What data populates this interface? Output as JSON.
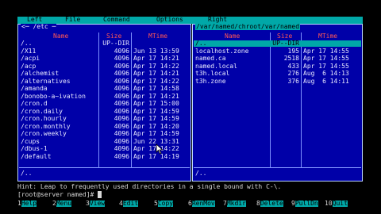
{
  "menu": [
    "Left",
    "File",
    "Command",
    "Options",
    "Right"
  ],
  "left_panel": {
    "path": "<─ /etc ─",
    "columns": {
      "name": "Name",
      "size": "Size",
      "mtime": "MTime"
    },
    "rows": [
      {
        "name": "/..",
        "size": "UP--DIR",
        "mtime": ""
      },
      {
        "name": "/X11",
        "size": "4096",
        "mtime": "Jun 13 13:59"
      },
      {
        "name": "/acpi",
        "size": "4096",
        "mtime": "Apr 17 14:21"
      },
      {
        "name": "/acp",
        "size": "4096",
        "mtime": "Apr 17 14:22"
      },
      {
        "name": "/alchemist",
        "size": "4096",
        "mtime": "Apr 17 14:21"
      },
      {
        "name": "/alternatives",
        "size": "4096",
        "mtime": "Apr 17 14:22"
      },
      {
        "name": "/amanda",
        "size": "4096",
        "mtime": "Apr 17 14:58"
      },
      {
        "name": "/bonobo-a~ivation",
        "size": "4096",
        "mtime": "Apr 17 14:21"
      },
      {
        "name": "/cron.d",
        "size": "4096",
        "mtime": "Apr 17 15:00"
      },
      {
        "name": "/cron.daily",
        "size": "4096",
        "mtime": "Apr 17 14:59"
      },
      {
        "name": "/cron.hourly",
        "size": "4096",
        "mtime": "Apr 17 14:59"
      },
      {
        "name": "/cron.monthly",
        "size": "4096",
        "mtime": "Apr 17 14:20"
      },
      {
        "name": "/cron.weekly",
        "size": "4096",
        "mtime": "Apr 17 14:59"
      },
      {
        "name": "/cups",
        "size": "4096",
        "mtime": "Jun 22 13:31"
      },
      {
        "name": "/dbus-1",
        "size": "4096",
        "mtime": "Apr 17 14:22"
      },
      {
        "name": "/default",
        "size": "4096",
        "mtime": "Apr 17 14:19"
      }
    ],
    "footer": "/.."
  },
  "right_panel": {
    "path": "/var/named/chroot/var/named",
    "columns": {
      "name": "Name",
      "size": "Size",
      "mtime": "MTime"
    },
    "rows": [
      {
        "name": "/..",
        "size": "UP--DIR",
        "mtime": ""
      },
      {
        "name": "localhost.zone",
        "size": "195",
        "mtime": "Apr 17 14:55"
      },
      {
        "name": "named.ca",
        "size": "2518",
        "mtime": "Apr 17 14:55"
      },
      {
        "name": "named.local",
        "size": "433",
        "mtime": "Apr 17 14:55"
      },
      {
        "name": "t3h.local",
        "size": "276",
        "mtime": "Aug  6 14:13"
      },
      {
        "name": "t3h.zone",
        "size": "376",
        "mtime": "Aug  6 14:11"
      }
    ],
    "footer": "/.."
  },
  "hint": "Hint: Leap to frequently used directories in a single bound with C-\\.",
  "prompt": "[root@server named]# ",
  "fkeys": [
    {
      "num": "1",
      "label": "Help"
    },
    {
      "num": "2",
      "label": "Menu"
    },
    {
      "num": "3",
      "label": "View"
    },
    {
      "num": "4",
      "label": "Edit"
    },
    {
      "num": "5",
      "label": "Copy"
    },
    {
      "num": "6",
      "label": "RenMov"
    },
    {
      "num": "7",
      "label": "Mkdir"
    },
    {
      "num": "8",
      "label": "Delete"
    },
    {
      "num": "9",
      "label": "PullDn"
    },
    {
      "num": "10",
      "label": "Quit"
    }
  ],
  "colors": {
    "panel_bg": "#0000a8",
    "menu_bg": "#00a8a8",
    "header_text": "#ff5555",
    "text": "#e8e8ff"
  }
}
